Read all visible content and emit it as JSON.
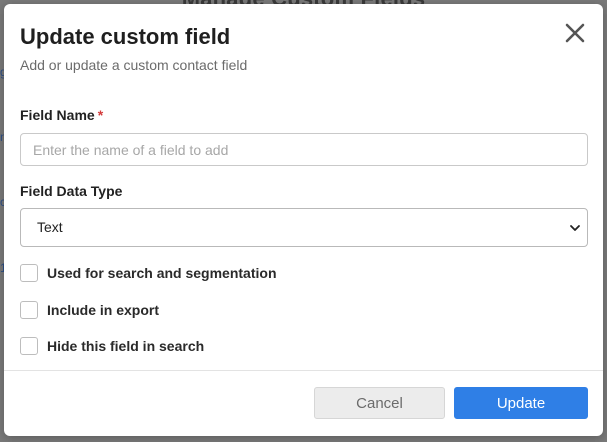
{
  "background": {
    "title": "Manage Custom Fields",
    "side_marks": [
      "g",
      "n",
      "c",
      "1"
    ]
  },
  "modal": {
    "title": "Update custom field",
    "subtitle": "Add or update a custom contact field",
    "close_icon": "close-icon"
  },
  "form": {
    "field_name": {
      "label": "Field Name",
      "required_mark": "*",
      "value": "",
      "placeholder": "Enter the name of a field to add"
    },
    "field_data_type": {
      "label": "Field Data Type",
      "selected": "Text",
      "icon": "chevron-down-icon"
    },
    "checkboxes": [
      {
        "label": "Used for search and segmentation",
        "checked": false
      },
      {
        "label": "Include in export",
        "checked": false
      },
      {
        "label": "Hide this field in search",
        "checked": false
      }
    ]
  },
  "footer": {
    "cancel_label": "Cancel",
    "update_label": "Update"
  },
  "colors": {
    "primary": "#2f7fe6",
    "required": "#d33b3b",
    "overlay": "#7a7a7a"
  }
}
